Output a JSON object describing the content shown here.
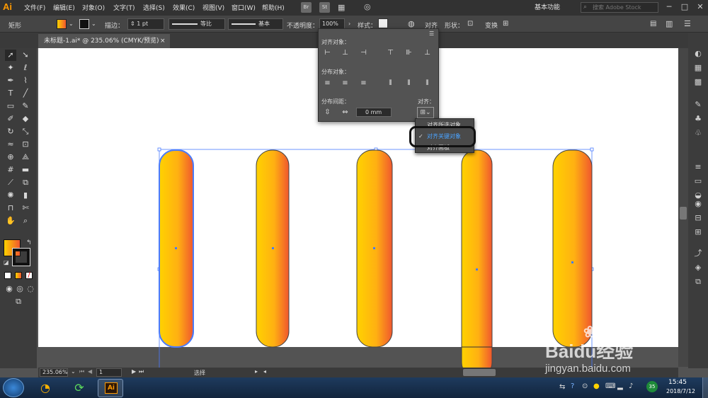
{
  "app": {
    "logo": "Ai"
  },
  "menu": [
    "文件(F)",
    "编辑(E)",
    "对象(O)",
    "文字(T)",
    "选择(S)",
    "效果(C)",
    "视图(V)",
    "窗口(W)",
    "帮助(H)"
  ],
  "menu_badges": [
    "Br",
    "St"
  ],
  "workspace": "基本功能",
  "search": {
    "placeholder": "搜索 Adobe Stock"
  },
  "control": {
    "object_type": "矩形",
    "stroke_label": "描边：",
    "stroke_value": "1 pt",
    "profile": "等比",
    "brush": "基本",
    "opacity_label": "不透明度：",
    "opacity_value": "100%",
    "style_label": "样式：",
    "align_label": "对齐",
    "shape_label": "形状：",
    "transform_label": "变换"
  },
  "document": {
    "tab_title": "未标题-1.ai* @ 235.06% (CMYK/预览)",
    "close": "×"
  },
  "align_panel": {
    "align_objects": "对齐对象：",
    "distribute_objects": "分布对象：",
    "distribute_spacing": "分布间距：",
    "spacing_value": "0 mm",
    "align_to": "对齐："
  },
  "dropdown": {
    "items": [
      "对齐所选对象",
      "对齐关键对象",
      "对齐画板"
    ],
    "selected_index": 1
  },
  "status": {
    "zoom": "235.06%",
    "page": "1",
    "tool": "选择"
  },
  "taskbar": {
    "time": "15:45",
    "date": "2018/7/12",
    "badge": "35",
    "ai_label": "Ai"
  },
  "watermark": {
    "brand": "Baidu经验",
    "url": "jingyan.baidu.com"
  },
  "colors": {
    "grad_start": "#ffd200",
    "grad_end": "#f0572e",
    "accent": "#ff9a00",
    "selection": "#4a7bff"
  }
}
